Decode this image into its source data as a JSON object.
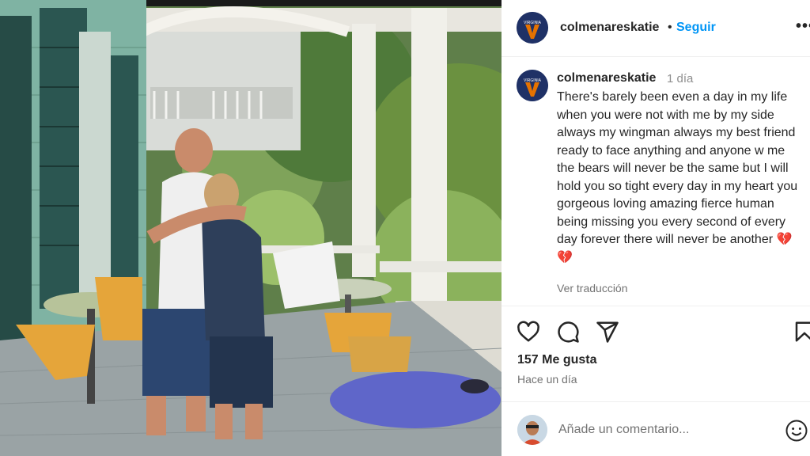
{
  "post": {
    "photo_alt": "Two men hugging on a porch with cafe tables and chairs",
    "author": "colmenareskatie",
    "avatar_text": "VIRGINIA",
    "follow_label": "Seguir",
    "more_label": "•••",
    "caption": {
      "username": "colmenareskatie",
      "time": "1 día",
      "text": "There's barely been even a day in my life when you were not with me by my side always my wingman always my best friend ready to face anything and anyone w me the bears will never be the same but I will hold you so tight every day in my heart you gorgeous loving amazing fierce human being missing you every second of every day forever there will never be another",
      "heart": "💔",
      "heart2": "💔",
      "translate_label": "Ver traducción"
    },
    "actions": {
      "icons": [
        "heart-outline-icon",
        "comment-icon",
        "share-icon",
        "bookmark-icon"
      ],
      "likes": "157 Me gusta",
      "posted_ago": "Hace un día"
    },
    "comment": {
      "placeholder": "Añade un comentario...",
      "emoji_icon": "smile-icon"
    },
    "colors": {
      "link": "#0095f6",
      "avatar_bg": "#1f3166",
      "avatar_v": "#e57200"
    }
  }
}
